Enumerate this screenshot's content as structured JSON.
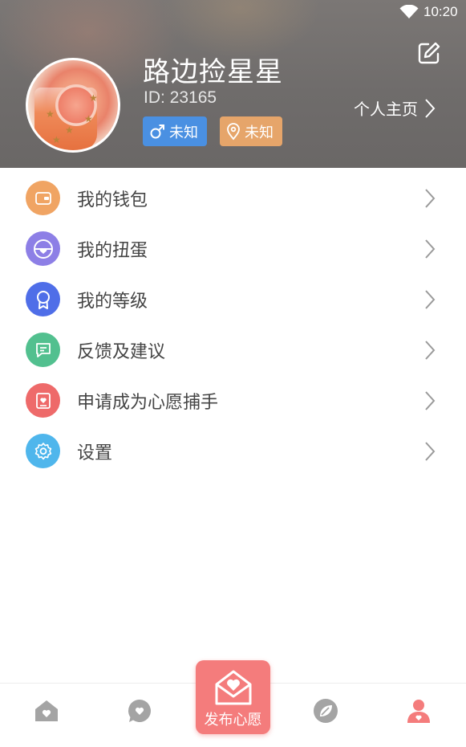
{
  "status_bar": {
    "time": "10:20"
  },
  "profile": {
    "nickname": "路边捡星星",
    "id_text": "ID: 23165",
    "gender_label": "未知",
    "location_label": "未知",
    "homepage_link": "个人主页"
  },
  "menu": {
    "items": [
      {
        "label": "我的钱包",
        "icon": "wallet-icon",
        "color": "#f0a463"
      },
      {
        "label": "我的扭蛋",
        "icon": "gashapon-icon",
        "color": "#8d7fe6"
      },
      {
        "label": "我的等级",
        "icon": "level-medal-icon",
        "color": "#4f6ee8"
      },
      {
        "label": "反馈及建议",
        "icon": "feedback-icon",
        "color": "#52c08f"
      },
      {
        "label": "申请成为心愿捕手",
        "icon": "wish-catcher-icon",
        "color": "#ee6a6a"
      },
      {
        "label": "设置",
        "icon": "settings-gear-icon",
        "color": "#4fb6ec"
      }
    ]
  },
  "bottom_nav": {
    "items": [
      {
        "name": "home",
        "icon": "home-icon",
        "active": false
      },
      {
        "name": "messages",
        "icon": "chat-heart-icon",
        "active": false
      },
      {
        "name": "publish",
        "icon": "envelope-heart-icon",
        "label": "发布心愿"
      },
      {
        "name": "discover",
        "icon": "compass-leaf-icon",
        "active": false
      },
      {
        "name": "me",
        "icon": "user-icon",
        "active": true
      }
    ]
  },
  "colors": {
    "accent": "#f47c7c",
    "gender_badge": "#4a90e2",
    "location_badge": "#e6a56a",
    "nav_inactive": "#9e9e9e"
  }
}
